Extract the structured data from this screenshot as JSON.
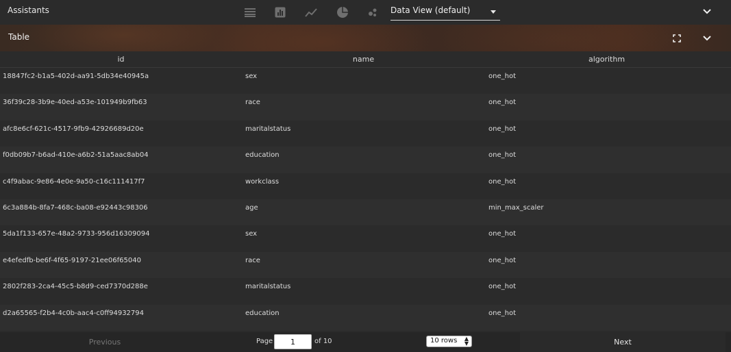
{
  "app": {
    "title": "Assistants"
  },
  "toolbar": {
    "visualizations": [
      {
        "name": "table-view-icon"
      },
      {
        "name": "bar-chart-icon"
      },
      {
        "name": "line-chart-icon"
      },
      {
        "name": "pie-chart-icon"
      },
      {
        "name": "scatter-plot-icon"
      }
    ],
    "view_select": {
      "selected": "Data View (default)"
    }
  },
  "panel": {
    "title": "Table"
  },
  "table": {
    "columns": [
      "id",
      "name",
      "algorithm"
    ],
    "rows": [
      [
        "18847fc2-b1a5-402d-aa91-5db34e40945a",
        "sex",
        "one_hot"
      ],
      [
        "36f39c28-3b9e-40ed-a53e-101949b9fb63",
        "race",
        "one_hot"
      ],
      [
        "afc8e6cf-621c-4517-9fb9-42926689d20e",
        "maritalstatus",
        "one_hot"
      ],
      [
        "f0db09b7-b6ad-410e-a6b2-51a5aac8ab04",
        "education",
        "one_hot"
      ],
      [
        "c4f9abac-9e86-4e0e-9a50-c16c111417f7",
        "workclass",
        "one_hot"
      ],
      [
        "6c3a884b-8fa7-468c-ba08-e92443c98306",
        "age",
        "min_max_scaler"
      ],
      [
        "5da1f133-657e-48a2-9733-956d16309094",
        "sex",
        "one_hot"
      ],
      [
        "e4efedfb-be6f-4f65-9197-21ee06f65040",
        "race",
        "one_hot"
      ],
      [
        "2802f283-2ca4-45c5-b8d9-ced7370d288e",
        "maritalstatus",
        "one_hot"
      ],
      [
        "d2a65565-f2b4-4c0b-aac4-c0ff94932794",
        "education",
        "one_hot"
      ]
    ]
  },
  "pagination": {
    "previous_label": "Previous",
    "next_label": "Next",
    "page_label": "Page",
    "current_page": "1",
    "of_label": "of 10",
    "rows_per_page": "10 rows"
  }
}
